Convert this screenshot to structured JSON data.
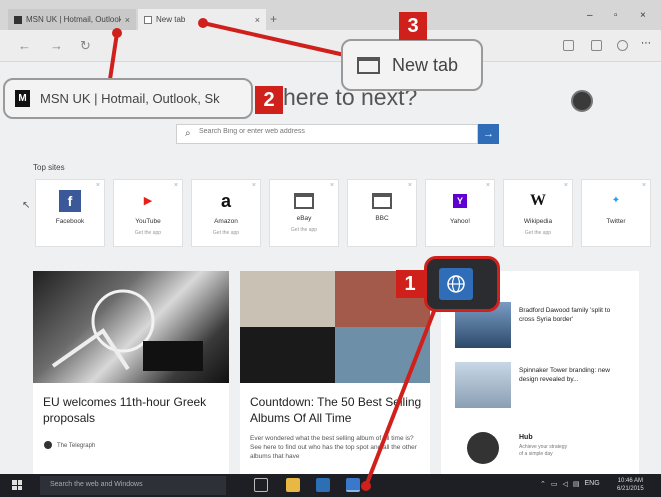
{
  "browser": {
    "tabs": [
      {
        "label": "MSN UK | Hotmail, Outlook, Sk",
        "close": "×",
        "active": false
      },
      {
        "label": "New tab",
        "close": "×",
        "active": true
      }
    ],
    "new_tab_button": "+",
    "window_controls": {
      "minimize": "–",
      "maximize": "▫",
      "close": "×"
    },
    "nav": {
      "back": "←",
      "forward": "→",
      "refresh": "↻"
    }
  },
  "page": {
    "heading": "here to next?",
    "search": {
      "placeholder": "Search Bing or enter web address",
      "go": "→"
    },
    "top_sites_title": "Top sites",
    "top_sites": [
      {
        "name": "Facebook",
        "sub": "",
        "glyph": "f",
        "color": "#3b5998"
      },
      {
        "name": "YouTube",
        "sub": "Get the app",
        "glyph": "▶",
        "color": "#e62117"
      },
      {
        "name": "Amazon",
        "sub": "Get the app",
        "glyph": "a",
        "color": "#ffffff"
      },
      {
        "name": "eBay",
        "sub": "Get the app",
        "glyph": "",
        "color": "#ffffff"
      },
      {
        "name": "BBC",
        "sub": "",
        "glyph": "",
        "color": "#ffffff"
      },
      {
        "name": "Yahoo!",
        "sub": "",
        "glyph": "Y",
        "color": "#5f01d1"
      },
      {
        "name": "Wikipedia",
        "sub": "Get the app",
        "glyph": "W",
        "color": "#ffffff"
      },
      {
        "name": "Twitter",
        "sub": "",
        "glyph": "🐦",
        "color": "#ffffff"
      }
    ],
    "tile_close": "×",
    "news": {
      "lead": {
        "headline": "EU welcomes 11th-hour Greek proposals",
        "source": "The Telegraph"
      },
      "second": {
        "headline": "Countdown: The 50 Best Selling Albums Of All Time",
        "body": "Ever wondered what the best selling album of all time is? See here to find out who has the top spot and all the other albums that have"
      },
      "side": [
        {
          "text": "Bradford Dawood family 'split to cross Syria border'"
        },
        {
          "text": "Spinnaker Tower branding: new design revealed by..."
        }
      ],
      "promo": {
        "title": "Hub",
        "line1": "Achieve your strategy",
        "line2": "of a simple day"
      }
    }
  },
  "taskbar": {
    "search_placeholder": "Search the web and Windows",
    "clock_time": "10:46 AM",
    "clock_date": "6/21/2015",
    "tray_lang": "ENG"
  },
  "annotations": {
    "callout_1": "1",
    "callout_2": "2",
    "callout_3": "3",
    "callout_msn_text": "MSN UK | Hotmail, Outlook, Sk",
    "callout_newtab_text": "New tab",
    "accent": "#d0201b"
  }
}
